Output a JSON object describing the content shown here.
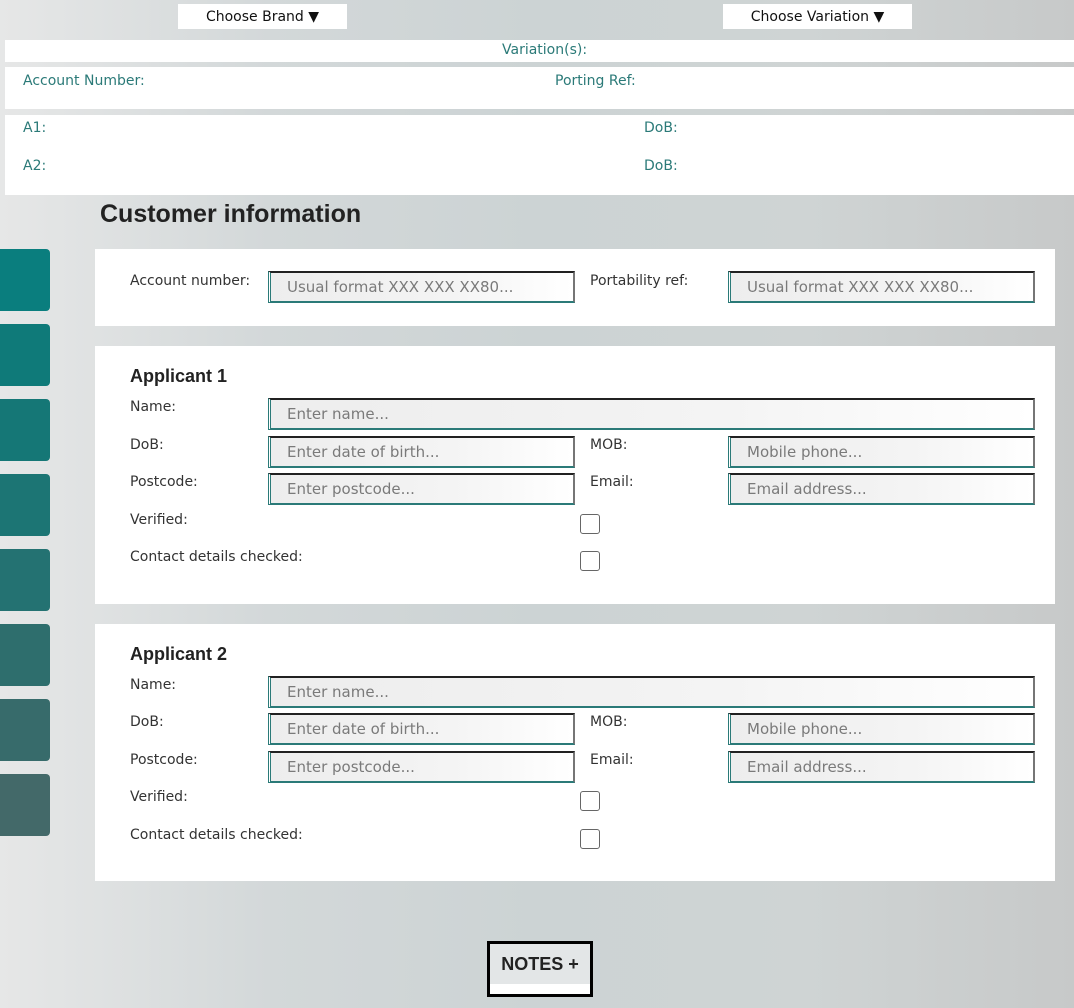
{
  "header": {
    "brand_dropdown": "Choose Brand ▼",
    "variation_dropdown": "Choose Variation ▼"
  },
  "summary": {
    "variations_label": "Variation(s):",
    "account_number_label": "Account Number:",
    "porting_ref_label": "Porting Ref:",
    "a1_label": "A1:",
    "a1_dob_label": "DoB:",
    "a2_label": "A2:",
    "a2_dob_label": "DoB:"
  },
  "sidebar": {
    "tiles": [
      {
        "color": "#0a7e7e"
      },
      {
        "color": "#0f7a79"
      },
      {
        "color": "#157776"
      },
      {
        "color": "#1c7574"
      },
      {
        "color": "#247272"
      },
      {
        "color": "#2e6e6d"
      },
      {
        "color": "#376b6b"
      },
      {
        "color": "#436969"
      }
    ]
  },
  "page_title": "Customer information",
  "account_card": {
    "account_number_label": "Account number:",
    "account_number_placeholder": "Usual format XXX XXX XX80...",
    "account_number_value": "",
    "portability_label": "Portability ref:",
    "portability_placeholder": "Usual format XXX XXX XX80...",
    "portability_value": ""
  },
  "applicants": [
    {
      "title": "Applicant 1",
      "name_label": "Name:",
      "name_placeholder": "Enter name...",
      "name_value": "",
      "dob_label": "DoB:",
      "dob_placeholder": "Enter date of birth...",
      "dob_value": "",
      "mob_label": "MOB:",
      "mob_placeholder": "Mobile phone...",
      "mob_value": "",
      "postcode_label": "Postcode:",
      "postcode_placeholder": "Enter postcode...",
      "postcode_value": "",
      "email_label": "Email:",
      "email_placeholder": "Email address...",
      "email_value": "",
      "verified_label": "Verified:",
      "verified": false,
      "contact_checked_label": "Contact details checked:",
      "contact_checked": false
    },
    {
      "title": "Applicant 2",
      "name_label": "Name:",
      "name_placeholder": "Enter name...",
      "name_value": "",
      "dob_label": "DoB:",
      "dob_placeholder": "Enter date of birth...",
      "dob_value": "",
      "mob_label": "MOB:",
      "mob_placeholder": "Mobile phone...",
      "mob_value": "",
      "postcode_label": "Postcode:",
      "postcode_placeholder": "Enter postcode...",
      "postcode_value": "",
      "email_label": "Email:",
      "email_placeholder": "Email address...",
      "email_value": "",
      "verified_label": "Verified:",
      "verified": false,
      "contact_checked_label": "Contact details checked:",
      "contact_checked": false
    }
  ],
  "notes_button": "NOTES +",
  "colors": {
    "accent_teal": "#2b7a78",
    "label_teal": "#2b7a78"
  }
}
